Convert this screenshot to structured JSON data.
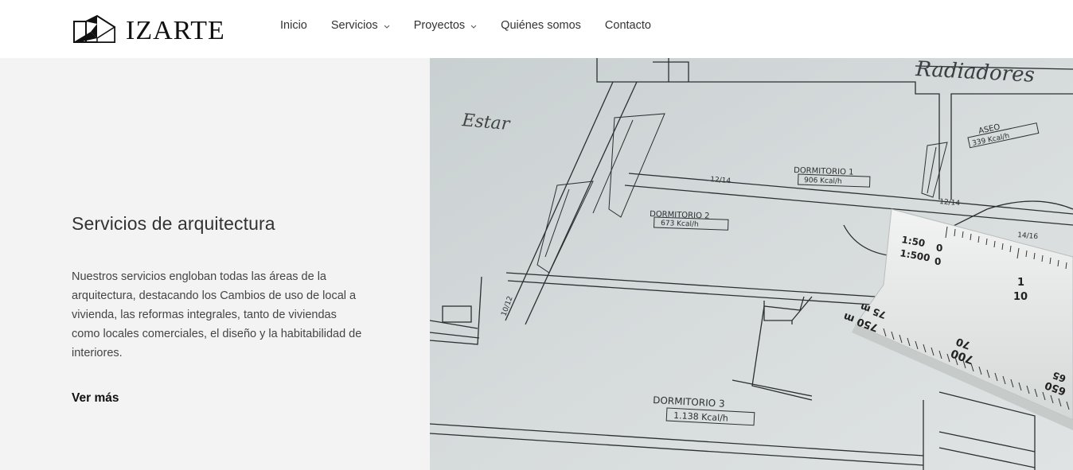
{
  "brand": {
    "name": "IZARTE",
    "logo_icon": "house-geometric-logo"
  },
  "nav": {
    "items": [
      {
        "label": "Inicio",
        "has_dropdown": false
      },
      {
        "label": "Servicios",
        "has_dropdown": true
      },
      {
        "label": "Proyectos",
        "has_dropdown": true
      },
      {
        "label": "Quiénes somos",
        "has_dropdown": false
      },
      {
        "label": "Contacto",
        "has_dropdown": false
      }
    ]
  },
  "hero": {
    "title": "Servicios de arquitectura",
    "description": "Nuestros servicios engloban todas las áreas de la arquitectura, destacando los Cambios de uso de local a vivienda, las reformas integrales, tanto de viviendas como locales comerciales, el diseño y la habitabilidad de interiores.",
    "cta_label": "Ver más"
  },
  "blueprint": {
    "handwritten_top": "Radiadores",
    "handwritten_left": "Estar",
    "rooms": [
      {
        "name": "DORMITORIO 1",
        "value": "906 Kcal/h"
      },
      {
        "name": "DORMITORIO 2",
        "value": "673 Kcal/h"
      },
      {
        "name": "DORMITORIO 3",
        "value": "1.138 Kcal/h"
      },
      {
        "name": "ASEO",
        "value": "339 Kcal/h"
      }
    ],
    "dimension_labels": [
      "12/14",
      "12/14",
      "10/12",
      "10/12",
      "14/16",
      "10/12"
    ],
    "ruler": {
      "scale_a": "1:50",
      "scale_b": "1:500",
      "marks": [
        "0",
        "0",
        "1",
        "10",
        "75 m",
        "750 m",
        "70",
        "700",
        "65",
        "650"
      ]
    }
  },
  "colors": {
    "left_panel": "#f3f3f3",
    "header": "#ffffff",
    "blueprint_bg": "#cfd5d6"
  }
}
